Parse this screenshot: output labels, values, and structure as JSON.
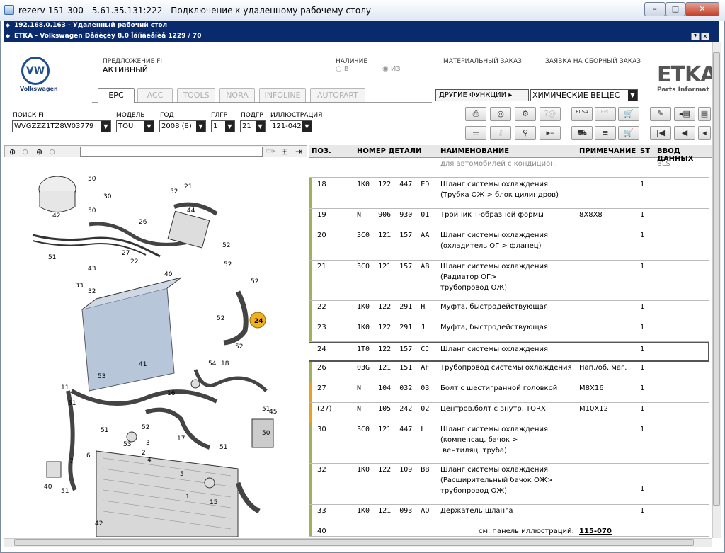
{
  "outer_window": {
    "title": "rezerv-151-300 - 5.61.35.131:222 - Подключение к удаленному рабочему столу"
  },
  "rdp_bar": {
    "title": "192.168.0.163 - Удаленный рабочий стол"
  },
  "app_bar": {
    "title": "ETKA - Volkswagen Ðåâèçèÿ 8.0 Îáíîâëåíèå 1229 / 70"
  },
  "brand": {
    "logo": "VW",
    "name": "Volkswagen",
    "etka": "ETKA",
    "etka_sub": "Parts Informat"
  },
  "header": {
    "offer_label": "ПРЕДЛОЖЕНИЕ FI",
    "offer_value": "АКТИВНЫЙ",
    "availability_label": "НАЛИЧИЕ",
    "radio_b": "В",
    "radio_iz": "ИЗ",
    "material_order": "МАТЕРИАЛЬНЫЙ ЗАКАЗ",
    "assembly_order": "ЗАЯВКА НА СБОРНЫЙ ЗАКАЗ"
  },
  "tabs": [
    "EPC",
    "ACC",
    "TOOLS",
    "NORA",
    "INFOLINE",
    "AUTOPART"
  ],
  "other_functions": "ДРУГИЕ ФУНКЦИИ ▸",
  "chemicals": "ХИМИЧЕСКИЕ ВЕЩЕС",
  "filters": {
    "search_fi": {
      "label": "ПОИСК FI",
      "value": "WVGZZZ1TZ8W03779"
    },
    "model": {
      "label": "МОДЕЛЬ",
      "value": "TOU"
    },
    "year": {
      "label": "ГОД",
      "value": "2008 (8)"
    },
    "mgroup": {
      "label": "ГЛГР",
      "value": "1"
    },
    "subgroup": {
      "label": "ПОДГР",
      "value": "21"
    },
    "illustration": {
      "label": "ИЛЛЮСТРАЦИЯ",
      "value": "121-042"
    }
  },
  "toolbar_labels": {
    "elsa": "ELSA",
    "depot": "DEPOT"
  },
  "table": {
    "headers": {
      "pos": "ПОЗ.",
      "part": "НОМЕР ДЕТАЛИ",
      "name": "НАИМЕНОВАНИЕ",
      "note": "ПРИМЕЧАНИЕ",
      "st": "ST",
      "input": "ВВОД ДАННЫХ"
    },
    "prefix_row": {
      "name": "для автомобилей с кондицион.",
      "input": "BLS"
    },
    "rows": [
      {
        "pos": "18",
        "part": "1K0  122  447  ED",
        "name": "Шланг системы охлаждения\n(Трубка ОЖ > блок цилиндров)",
        "note": "",
        "st": "1",
        "bar": "green"
      },
      {
        "pos": "19",
        "part": "N    906  930  01",
        "name": "Тройник Т-образной формы",
        "note": "8X8X8",
        "st": "1",
        "bar": "green"
      },
      {
        "pos": "20",
        "part": "3C0  121  157  AA",
        "name": "Шланг системы охлаждения\n(охладитель ОГ > фланец)",
        "note": "",
        "st": "1",
        "bar": "green"
      },
      {
        "pos": "21",
        "part": "3C0  121  157  AB",
        "name": "Шланг системы охлаждения\n(Радиатор ОГ>\nтрубопровод ОЖ)",
        "note": "",
        "st": "1",
        "bar": "green"
      },
      {
        "pos": "22",
        "part": "1K0  122  291  H",
        "name": "Муфта, быстродействующая",
        "note": "",
        "st": "1",
        "bar": "green"
      },
      {
        "pos": "23",
        "part": "1K0  122  291  J",
        "name": "Муфта, быстродействующая",
        "note": "",
        "st": "1",
        "bar": "green"
      },
      {
        "pos": "24",
        "part": "1T0  122  157  CJ",
        "name": "Шланг системы охлаждения",
        "note": "",
        "st": "1",
        "bar": "none"
      },
      {
        "pos": "26",
        "part": "03G  121  151  AF",
        "name": "Трубопровод системы охлаждения",
        "note": "Нап./об. маг.",
        "st": "1",
        "bar": "green"
      },
      {
        "pos": "27",
        "part": "N    104  032  03",
        "name": "Болт с шестигранной головкой",
        "note": "M8X16",
        "st": "1",
        "bar": "orange"
      },
      {
        "pos": "(27)",
        "part": "N    105  242  02",
        "name": "Центров.болт с внутр. TORX",
        "note": "M10X12",
        "st": "1",
        "bar": "orange"
      },
      {
        "pos": "30",
        "part": "3C0  121  447  L",
        "name": "Шланг системы охлаждения\n(компенсац. бачок >\n вентиляц. труба)",
        "note": "",
        "st": "1",
        "bar": "green"
      },
      {
        "pos": "32",
        "part": "1K0  122  109  BB",
        "name": "Шланг системы охлаждения\n(Расширительный бачок ОЖ>\nтрубопровод ОЖ)",
        "note": "",
        "st": "1",
        "bar": "green"
      },
      {
        "pos": "33",
        "part": "1K0  121  093  AQ",
        "name": "Держатель шланга",
        "note": "",
        "st": "1",
        "bar": "green"
      },
      {
        "pos": "40",
        "part": "",
        "name": "см. панель иллюстраций:",
        "note": "115-070",
        "st": "",
        "bar": "green"
      }
    ]
  },
  "diagram": {
    "labels": [
      "50",
      "30",
      "42",
      "50",
      "21",
      "52",
      "44",
      "26",
      "27",
      "52",
      "52",
      "51",
      "43",
      "22",
      "33",
      "32",
      "40",
      "52",
      "24",
      "52",
      "52",
      "54",
      "18",
      "11",
      "53",
      "41",
      "16",
      "51",
      "51",
      "52",
      "53",
      "51",
      "45",
      "50",
      "17",
      "3",
      "2",
      "15",
      "51",
      "7",
      "6",
      "40",
      "51",
      "42",
      "5",
      "1",
      "4"
    ],
    "highlight": "24"
  }
}
